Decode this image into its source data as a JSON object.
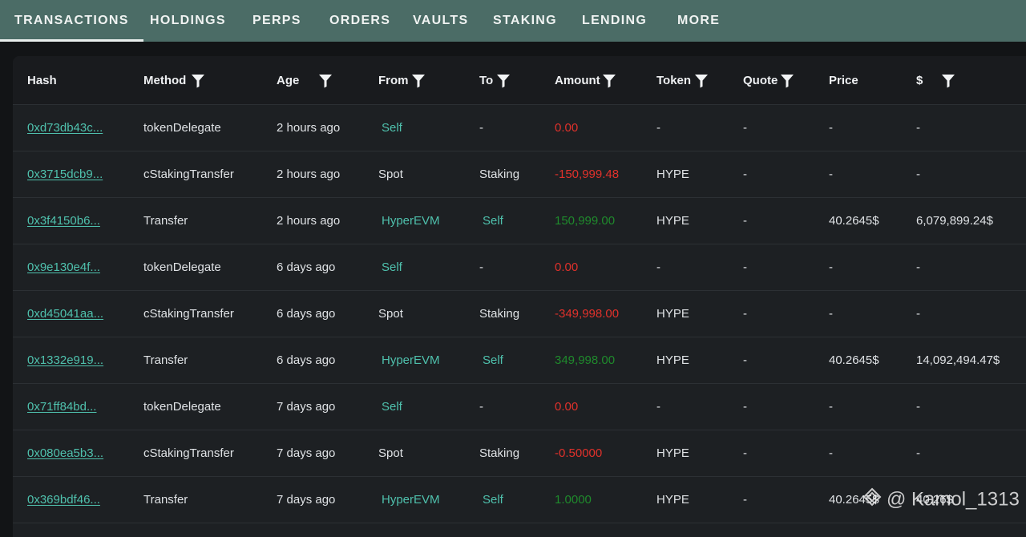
{
  "tabs": [
    {
      "label": "TRANSACTIONS",
      "active": true
    },
    {
      "label": "HOLDINGS"
    },
    {
      "label": "PERPS"
    },
    {
      "label": "ORDERS"
    },
    {
      "label": "VAULTS"
    },
    {
      "label": "STAKING"
    },
    {
      "label": "LENDING"
    },
    {
      "label": "MORE"
    }
  ],
  "columns": [
    {
      "label": "Hash",
      "filter": false
    },
    {
      "label": "Method",
      "filter": true
    },
    {
      "label": "Age",
      "filter": true
    },
    {
      "label": "From",
      "filter": true
    },
    {
      "label": "To",
      "filter": true
    },
    {
      "label": "Amount",
      "filter": true
    },
    {
      "label": "Token",
      "filter": true
    },
    {
      "label": "Quote",
      "filter": true
    },
    {
      "label": "Price",
      "filter": false
    },
    {
      "label": "$",
      "filter": true
    }
  ],
  "rows": [
    {
      "hash": "0xd73db43c...",
      "method": "tokenDelegate",
      "age": "2 hours ago",
      "from": "Self",
      "to": "-",
      "amount": "0.00",
      "amount_kind": "zero",
      "token": "-",
      "quote": "-",
      "price": "-",
      "usd": "-"
    },
    {
      "hash": "0x3715dcb9...",
      "method": "cStakingTransfer",
      "age": "2 hours ago",
      "from": "Spot",
      "to": "Staking",
      "amount": "-150,999.48",
      "amount_kind": "neg",
      "token": "HYPE",
      "quote": "-",
      "price": "-",
      "usd": "-"
    },
    {
      "hash": "0x3f4150b6...",
      "method": "Transfer",
      "age": "2 hours ago",
      "from": "HyperEVM",
      "to": "Self",
      "amount": "150,999.00",
      "amount_kind": "pos",
      "token": "HYPE",
      "quote": "-",
      "price": "40.2645$",
      "usd": "6,079,899.24$"
    },
    {
      "hash": "0x9e130e4f...",
      "method": "tokenDelegate",
      "age": "6 days ago",
      "from": "Self",
      "to": "-",
      "amount": "0.00",
      "amount_kind": "zero",
      "token": "-",
      "quote": "-",
      "price": "-",
      "usd": "-"
    },
    {
      "hash": "0xd45041aa...",
      "method": "cStakingTransfer",
      "age": "6 days ago",
      "from": "Spot",
      "to": "Staking",
      "amount": "-349,998.00",
      "amount_kind": "neg",
      "token": "HYPE",
      "quote": "-",
      "price": "-",
      "usd": "-"
    },
    {
      "hash": "0x1332e919...",
      "method": "Transfer",
      "age": "6 days ago",
      "from": "HyperEVM",
      "to": "Self",
      "amount": "349,998.00",
      "amount_kind": "pos",
      "token": "HYPE",
      "quote": "-",
      "price": "40.2645$",
      "usd": "14,092,494.47$"
    },
    {
      "hash": "0x71ff84bd...",
      "method": "tokenDelegate",
      "age": "7 days ago",
      "from": "Self",
      "to": "-",
      "amount": "0.00",
      "amount_kind": "zero",
      "token": "-",
      "quote": "-",
      "price": "-",
      "usd": "-"
    },
    {
      "hash": "0x080ea5b3...",
      "method": "cStakingTransfer",
      "age": "7 days ago",
      "from": "Spot",
      "to": "Staking",
      "amount": "-0.50000",
      "amount_kind": "neg",
      "token": "HYPE",
      "quote": "-",
      "price": "-",
      "usd": "-"
    },
    {
      "hash": "0x369bdf46...",
      "method": "Transfer",
      "age": "7 days ago",
      "from": "HyperEVM",
      "to": "Self",
      "amount": "1.0000",
      "amount_kind": "pos",
      "token": "HYPE",
      "quote": "-",
      "price": "40.2645$",
      "usd": "40.26$"
    }
  ],
  "watermark": "@ Kamol_1313",
  "icons": {
    "filter": "filter-funnel-icon",
    "watermark_logo": "binance-square-logo-icon"
  },
  "colors": {
    "tabbar": "#4b6c66",
    "link": "#4fc1ad",
    "negative": "#e0312b",
    "positive": "#1f8a2c",
    "panel": "#1d2023"
  }
}
